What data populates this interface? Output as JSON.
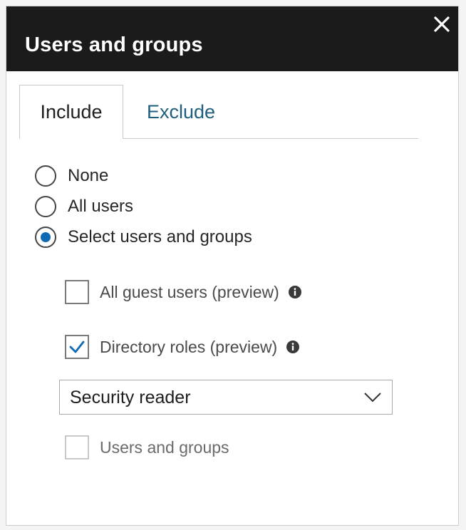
{
  "panel": {
    "title": "Users and groups",
    "close_icon": "close-icon"
  },
  "tabs": [
    {
      "label": "Include",
      "active": true
    },
    {
      "label": "Exclude",
      "active": false
    }
  ],
  "radios": [
    {
      "label": "None",
      "selected": false
    },
    {
      "label": "All users",
      "selected": false
    },
    {
      "label": "Select users and groups",
      "selected": true
    }
  ],
  "options": {
    "guest_users": {
      "label": "All guest users (preview)",
      "checked": false,
      "info_icon": "info-icon"
    },
    "directory_roles": {
      "label": "Directory roles (preview)",
      "checked": true,
      "info_icon": "info-icon"
    },
    "role_select": {
      "value": "Security reader",
      "icon": "chevron-down-icon"
    },
    "users_and_groups": {
      "label": "Users and groups",
      "checked": false,
      "disabled": true
    }
  },
  "colors": {
    "header_bg": "#1b1b1b",
    "accent": "#0f6ab4",
    "tab_link": "#1f5f7d"
  }
}
